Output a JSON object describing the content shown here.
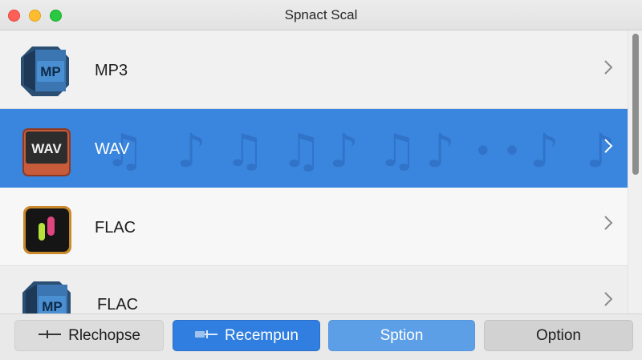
{
  "window": {
    "title": "Spnact Scal"
  },
  "list": {
    "items": [
      {
        "label": "MP3",
        "icon": "mp3-file-icon",
        "icon_text": "MP",
        "selected": false
      },
      {
        "label": "WAV",
        "icon": "wav-file-icon",
        "icon_text": "WAV",
        "selected": true
      },
      {
        "label": "FLAC",
        "icon": "flac-app-icon",
        "selected": false
      },
      {
        "label": "FLAC",
        "icon": "mp3-file-icon",
        "icon_text": "MP",
        "selected": false
      }
    ],
    "selection_color": "#3a86df"
  },
  "toolbar": {
    "buttons": [
      {
        "label": "Rlechopse",
        "icon": "minus-line-icon"
      },
      {
        "label": "Recempun",
        "icon": "slider-icon"
      },
      {
        "label": "Sption"
      },
      {
        "label": "Option"
      }
    ]
  }
}
